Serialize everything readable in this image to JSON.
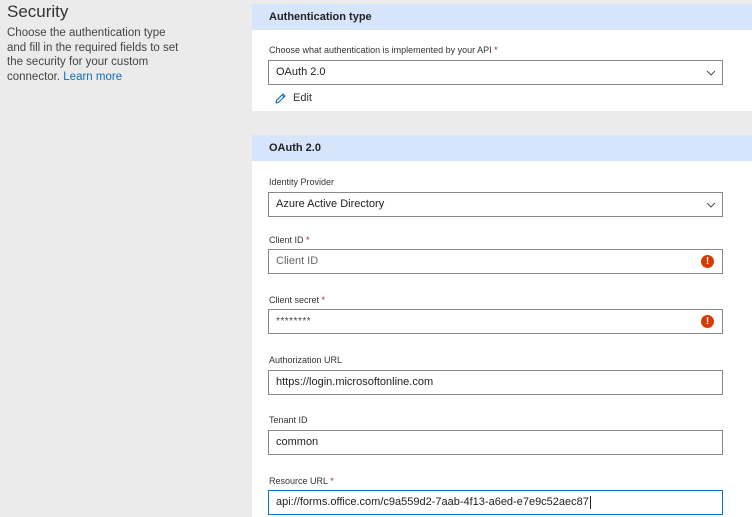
{
  "security": {
    "title": "Security",
    "description": "Choose the authentication type and fill in the required fields to set the security for your custom connector.",
    "learn_more": "Learn more"
  },
  "auth_type": {
    "header": "Authentication type",
    "label": "Choose what authentication is implemented by your API",
    "required_mark": "*",
    "selected": "OAuth 2.0",
    "edit_label": "Edit"
  },
  "oauth": {
    "header": "OAuth 2.0",
    "identity_provider": {
      "label": "Identity Provider",
      "selected": "Azure Active Directory"
    },
    "client_id": {
      "label": "Client ID",
      "required_mark": "*",
      "placeholder": "Client ID",
      "error_glyph": "!"
    },
    "client_secret": {
      "label": "Client secret",
      "required_mark": "*",
      "value": "********",
      "error_glyph": "!"
    },
    "authorization_url": {
      "label": "Authorization URL",
      "value": "https://login.microsoftonline.com"
    },
    "tenant_id": {
      "label": "Tenant ID",
      "value": "common"
    },
    "resource_url": {
      "label": "Resource URL",
      "required_mark": "*",
      "value": "api://forms.office.com/c9a559d2-7aab-4f13-a6ed-e7e9c52aec87"
    }
  },
  "colors": {
    "header_bg": "#d6e4fc",
    "link": "#0f6cbd",
    "error": "#d83b01",
    "focus_border": "#0078d4",
    "page_bg": "#ebebeb"
  }
}
